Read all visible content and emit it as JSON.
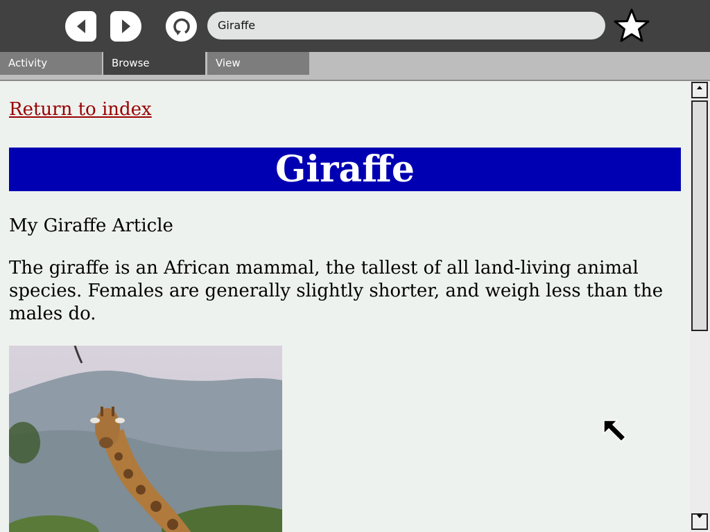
{
  "toolbar": {
    "back_icon": "back-arrow-icon",
    "forward_icon": "forward-arrow-icon",
    "reload_icon": "reload-icon",
    "url_value": "Giraffe",
    "bookmark_icon": "star-icon"
  },
  "tabs": [
    {
      "label": "Activity"
    },
    {
      "label": "Browse",
      "active": true
    },
    {
      "label": "View"
    }
  ],
  "page": {
    "return_link": "Return to index",
    "title": "Giraffe",
    "subtitle": "My Giraffe Article",
    "body": "The giraffe is an African mammal, the tallest of all land-living animal species. Females are generally slightly shorter, and weigh less than the males do.",
    "image_subject": "giraffe-photo"
  },
  "colors": {
    "toolbar_bg": "#414141",
    "title_banner_bg": "#0000b2",
    "link_color": "#990000",
    "content_bg": "#eef2ef"
  }
}
